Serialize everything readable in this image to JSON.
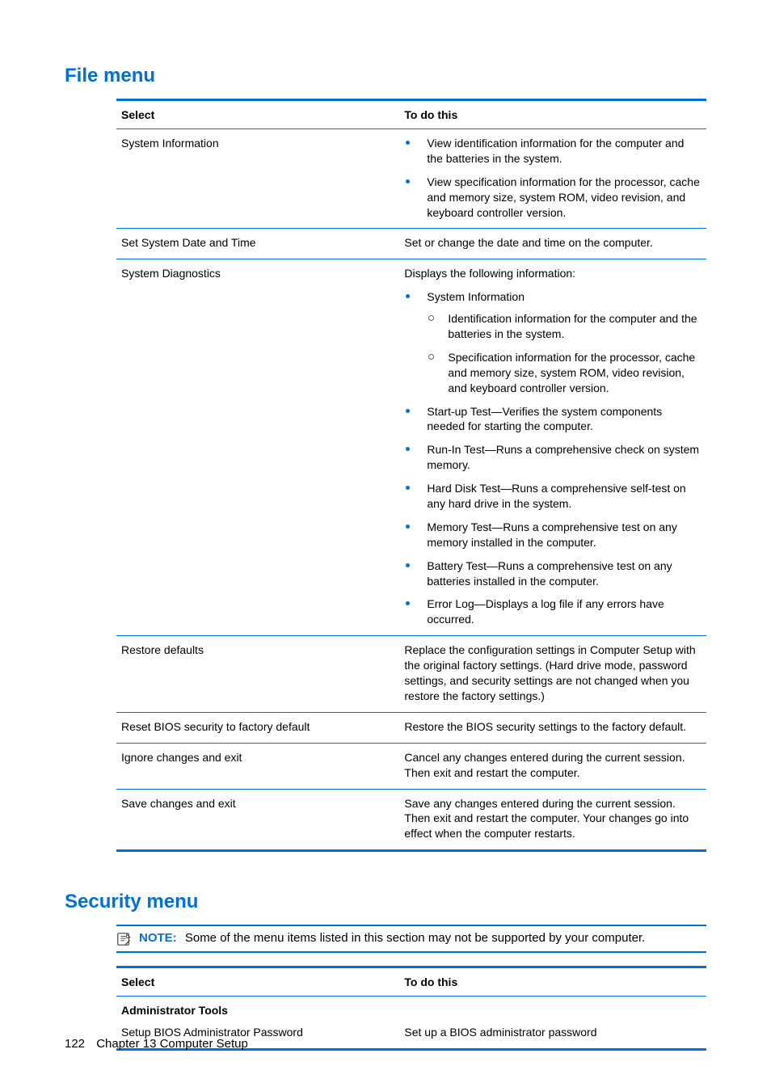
{
  "sections": {
    "file_menu": {
      "heading": "File menu",
      "headers": {
        "select": "Select",
        "todo": "To do this"
      },
      "rows": {
        "sys_info": {
          "select": "System Information",
          "bullets": [
            "View identification information for the computer and the batteries in the system.",
            "View specification information for the processor, cache and memory size, system ROM, video revision, and keyboard controller version."
          ]
        },
        "set_date": {
          "select": "Set System Date and Time",
          "text": "Set or change the date and time on the computer."
        },
        "diagnostics": {
          "select": "System Diagnostics",
          "intro": "Displays the following information:",
          "bullet1_label": "System Information",
          "sub": [
            "Identification information for the computer and the batteries in the system.",
            "Specification information for the processor, cache and memory size, system ROM, video revision, and keyboard controller version."
          ],
          "rest": [
            "Start-up Test—Verifies the system components needed for starting the computer.",
            "Run-In Test—Runs a comprehensive check on system memory.",
            "Hard Disk Test—Runs a comprehensive self-test on any hard drive in the system.",
            "Memory Test—Runs a comprehensive test on any memory installed in the computer.",
            "Battery Test—Runs a comprehensive test on any batteries installed in the computer.",
            "Error Log—Displays a log file if any errors have occurred."
          ]
        },
        "restore_defaults": {
          "select": "Restore defaults",
          "text": "Replace the configuration settings in Computer Setup with the original factory settings. (Hard drive mode, password settings, and security settings are not changed when you restore the factory settings.)"
        },
        "reset_bios": {
          "select": "Reset BIOS security to factory default",
          "text": "Restore the BIOS security settings to the factory default."
        },
        "ignore_exit": {
          "select": "Ignore changes and exit",
          "text": "Cancel any changes entered during the current session. Then exit and restart the computer."
        },
        "save_exit": {
          "select": "Save changes and exit",
          "text": "Save any changes entered during the current session. Then exit and restart the computer. Your changes go into effect when the computer restarts."
        }
      }
    },
    "security_menu": {
      "heading": "Security menu",
      "note_label": "NOTE:",
      "note_text": "Some of the menu items listed in this section may not be supported by your computer.",
      "headers": {
        "select": "Select",
        "todo": "To do this"
      },
      "rows": {
        "admin_tools": {
          "label": "Administrator Tools"
        },
        "setup_bios_pwd": {
          "select": "Setup BIOS Administrator Password",
          "text": "Set up a BIOS administrator password"
        }
      }
    }
  },
  "footer": {
    "page_number": "122",
    "chapter": "Chapter 13   Computer Setup"
  }
}
